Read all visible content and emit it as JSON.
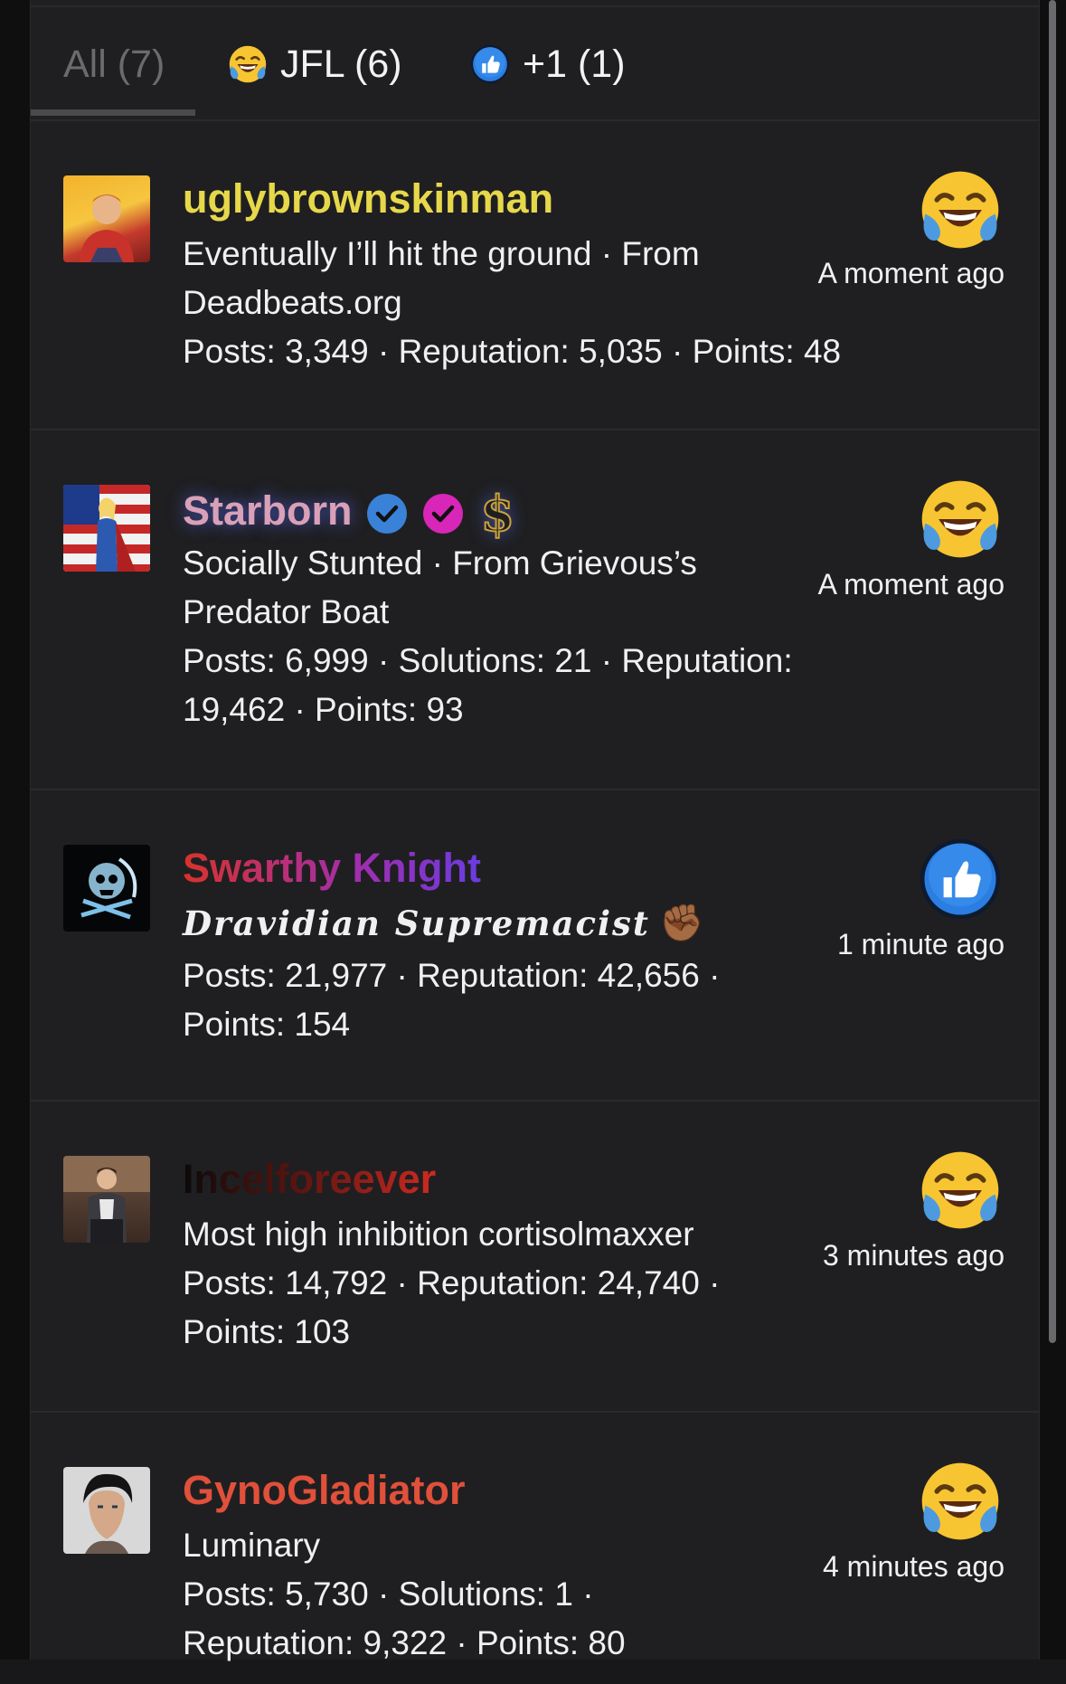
{
  "tabs": [
    {
      "label": "All (7)",
      "icon": "none"
    },
    {
      "label": "JFL (6)",
      "icon": "laughing-crying-emoji"
    },
    {
      "label": "+1 (1)",
      "icon": "thumbs-up-emoji"
    }
  ],
  "reactions": [
    {
      "username": "uglybrownskinman",
      "name_color": "#e6d84a",
      "bio": "Eventually I’ll hit the ground · From Deadbeats.org",
      "stats": "Posts: 3,349 · Reputation: 5,035 · Points: 48",
      "reaction_icon": "laughing-crying-emoji",
      "time": "A moment ago"
    },
    {
      "username": "Starborn",
      "name_color": "#d9a0b8",
      "bio": "Socially Stunted · From Grievous’s Predator Boat",
      "stats": "Posts: 6,999 · Solutions: 21 · Reputation: 19,462 · Points: 93",
      "reaction_icon": "laughing-crying-emoji",
      "time": "A moment ago",
      "badges": [
        "blue-verified-icon",
        "pink-verified-icon",
        "dollar-icon"
      ],
      "dollar_glyph": "$"
    },
    {
      "username": "Swarthy Knight",
      "name_color": "#b030a8",
      "bio": "Dravidian Supremacist",
      "bio_emoji": "✊🏾",
      "stats": "Posts: 21,977 · Reputation: 42,656 · Points: 154",
      "reaction_icon": "thumbs-up-emoji",
      "time": "1 minute ago"
    },
    {
      "username": "Incelforeever",
      "name_color": "#c83228",
      "bio": "Most high inhibition cortisolmaxxer",
      "stats": "Posts: 14,792 · Reputation: 24,740 · Points: 103",
      "reaction_icon": "laughing-crying-emoji",
      "time": "3 minutes ago"
    },
    {
      "username": "GynoGladiator",
      "name_color": "#e0503a",
      "bio": "Luminary",
      "stats": "Posts: 5,730 · Solutions: 1 · Reputation: 9,322 · Points: 80",
      "reaction_icon": "laughing-crying-emoji",
      "time": "4 minutes ago"
    }
  ]
}
